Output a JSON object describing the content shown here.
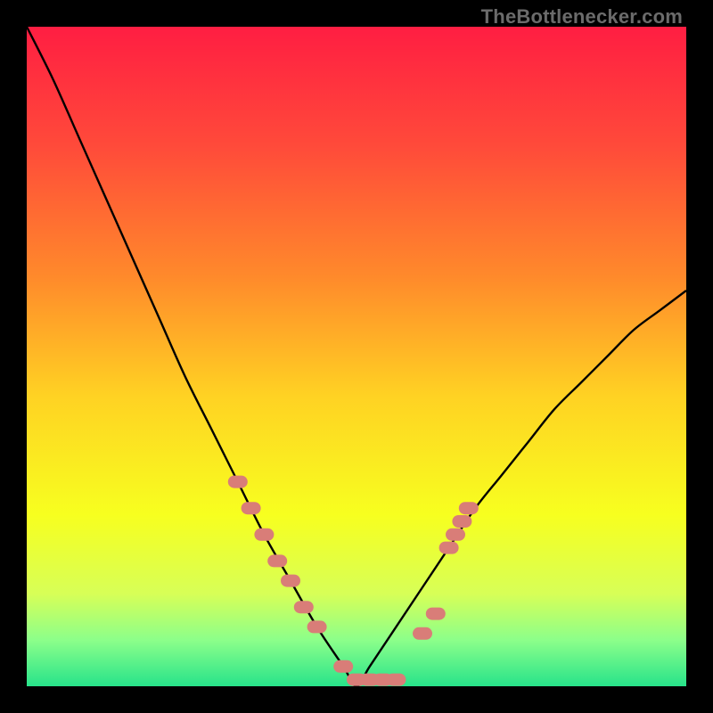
{
  "watermark": "TheBottlenecker.com",
  "chart_data": {
    "type": "line",
    "title": "",
    "xlabel": "",
    "ylabel": "",
    "xlim": [
      0,
      100
    ],
    "ylim": [
      0,
      100
    ],
    "grid": false,
    "legend": false,
    "background_gradient_stops": [
      {
        "offset": 0.0,
        "color": "#ff1e42"
      },
      {
        "offset": 0.18,
        "color": "#ff4a3a"
      },
      {
        "offset": 0.38,
        "color": "#ff8a2b"
      },
      {
        "offset": 0.56,
        "color": "#ffd223"
      },
      {
        "offset": 0.74,
        "color": "#f7ff1f"
      },
      {
        "offset": 0.86,
        "color": "#d7ff57"
      },
      {
        "offset": 0.93,
        "color": "#8cff8a"
      },
      {
        "offset": 1.0,
        "color": "#27e38a"
      }
    ],
    "curve": {
      "name": "bottleneck-curve",
      "color": "#000000",
      "x": [
        0,
        4,
        8,
        12,
        16,
        20,
        24,
        28,
        32,
        36,
        40,
        44,
        48,
        50,
        52,
        56,
        60,
        64,
        68,
        72,
        76,
        80,
        84,
        88,
        92,
        96,
        100
      ],
      "y": [
        100,
        92,
        83,
        74,
        65,
        56,
        47,
        39,
        31,
        23,
        16,
        9,
        3,
        0,
        3,
        9,
        15,
        21,
        27,
        32,
        37,
        42,
        46,
        50,
        54,
        57,
        60
      ]
    },
    "highlight_markers": {
      "name": "highlighted-points",
      "color": "#d97d78",
      "shape": "capsule",
      "points": [
        {
          "x": 32,
          "y": 31
        },
        {
          "x": 34,
          "y": 27
        },
        {
          "x": 36,
          "y": 23
        },
        {
          "x": 38,
          "y": 19
        },
        {
          "x": 40,
          "y": 16
        },
        {
          "x": 42,
          "y": 12
        },
        {
          "x": 44,
          "y": 9
        },
        {
          "x": 48,
          "y": 3
        },
        {
          "x": 50,
          "y": 1
        },
        {
          "x": 52,
          "y": 1
        },
        {
          "x": 54,
          "y": 1
        },
        {
          "x": 56,
          "y": 1
        },
        {
          "x": 60,
          "y": 8
        },
        {
          "x": 62,
          "y": 11
        },
        {
          "x": 64,
          "y": 21
        },
        {
          "x": 65,
          "y": 23
        },
        {
          "x": 66,
          "y": 25
        },
        {
          "x": 67,
          "y": 27
        }
      ]
    }
  }
}
